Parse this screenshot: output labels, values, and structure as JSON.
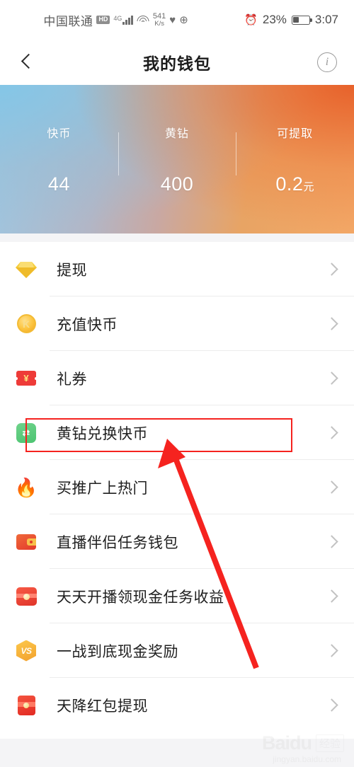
{
  "statusbar": {
    "carrier": "中国联通",
    "hd_badge": "HD",
    "network": "4G",
    "speed_value": "541",
    "speed_unit": "K/s",
    "battery_percent": "23%",
    "clock": "3:07",
    "icons": [
      "hd-icon",
      "signal-bars-icon",
      "wifi-icon",
      "network-speed-icon",
      "heart-icon",
      "globe-icon",
      "alarm-icon",
      "battery-icon"
    ]
  },
  "navbar": {
    "back_label": "",
    "title": "我的钱包",
    "info_label": "i"
  },
  "balance": {
    "columns": [
      {
        "label": "快币",
        "value": "44",
        "unit": ""
      },
      {
        "label": "黄钻",
        "value": "400",
        "unit": ""
      },
      {
        "label": "可提取",
        "value": "0.2",
        "unit": "元"
      }
    ]
  },
  "menu": {
    "items": [
      {
        "label": "提现",
        "icon": "diamond-icon"
      },
      {
        "label": "充值快币",
        "icon": "k-coin-icon",
        "glyph": "K"
      },
      {
        "label": "礼券",
        "icon": "ticket-icon",
        "glyph": "¥"
      },
      {
        "label": "黄钻兑换快币",
        "icon": "exchange-icon",
        "glyph": "⇄"
      },
      {
        "label": "买推广上热门",
        "icon": "flame-icon",
        "glyph": "🔥"
      },
      {
        "label": "直播伴侣任务钱包",
        "icon": "wallet-icon"
      },
      {
        "label": "天天开播领现金任务收益",
        "icon": "gift-box-icon"
      },
      {
        "label": "一战到底现金奖励",
        "icon": "vs-badge-icon",
        "glyph": "VS"
      },
      {
        "label": "天降红包提现",
        "icon": "red-envelope-icon"
      }
    ]
  },
  "annotation": {
    "highlight_row_index": 3,
    "box_color": "#f5231f",
    "arrow_color": "#f5231f"
  },
  "watermark": {
    "brand": "Baidu",
    "badge": "经验",
    "url": "jingyan.baidu.com"
  },
  "colors": {
    "accent_orange": "#e75e28",
    "accent_blue": "#83c6e7",
    "annotation_red": "#f5231f",
    "text_primary": "#1f1f1f",
    "chevron_gray": "#c2c2c2"
  }
}
